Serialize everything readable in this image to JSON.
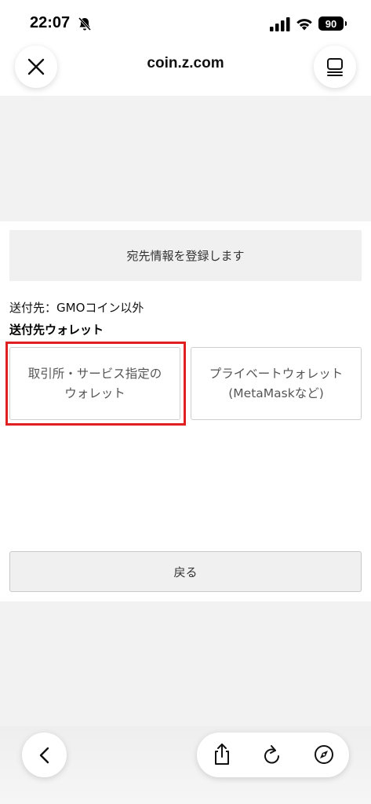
{
  "status": {
    "time": "22:07",
    "battery": "90"
  },
  "browser": {
    "url": "coin.z.com"
  },
  "page": {
    "banner": "宛先情報を登録します",
    "destination": "送付先：GMOコイン以外",
    "wallet_label": "送付先ウォレット",
    "options": [
      {
        "line1": "取引所・サービス指定の",
        "line2": "ウォレット"
      },
      {
        "line1": "プライベートウォレット",
        "line2": "(MetaMaskなど)"
      }
    ],
    "back_label": "戻る"
  },
  "colors": {
    "highlight": "#e02020"
  },
  "icons": {
    "close": "close-icon",
    "tabs": "tabs-icon",
    "back": "chevron-left-icon",
    "share": "share-icon",
    "reload": "reload-icon",
    "compass": "compass-icon"
  }
}
